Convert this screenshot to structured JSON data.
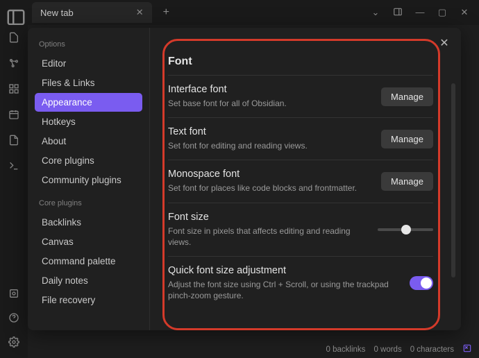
{
  "tab": {
    "title": "New tab"
  },
  "settings": {
    "nav": {
      "group1_header": "Options",
      "group1": [
        "Editor",
        "Files & Links",
        "Appearance",
        "Hotkeys",
        "About",
        "Core plugins",
        "Community plugins"
      ],
      "active_index": 2,
      "group2_header": "Core plugins",
      "group2": [
        "Backlinks",
        "Canvas",
        "Command palette",
        "Daily notes",
        "File recovery"
      ]
    },
    "section_title": "Font",
    "rows": {
      "interface": {
        "title": "Interface font",
        "desc": "Set base font for all of Obsidian.",
        "button": "Manage"
      },
      "text": {
        "title": "Text font",
        "desc": "Set font for editing and reading views.",
        "button": "Manage"
      },
      "mono": {
        "title": "Monospace font",
        "desc": "Set font for places like code blocks and frontmatter.",
        "button": "Manage"
      },
      "size": {
        "title": "Font size",
        "desc": "Font size in pixels that affects editing and reading views."
      },
      "quick": {
        "title": "Quick font size adjustment",
        "desc": "Adjust the font size using Ctrl + Scroll, or using the trackpad pinch-zoom gesture."
      }
    }
  },
  "status": {
    "backlinks": "0 backlinks",
    "words": "0 words",
    "chars": "0 characters"
  }
}
